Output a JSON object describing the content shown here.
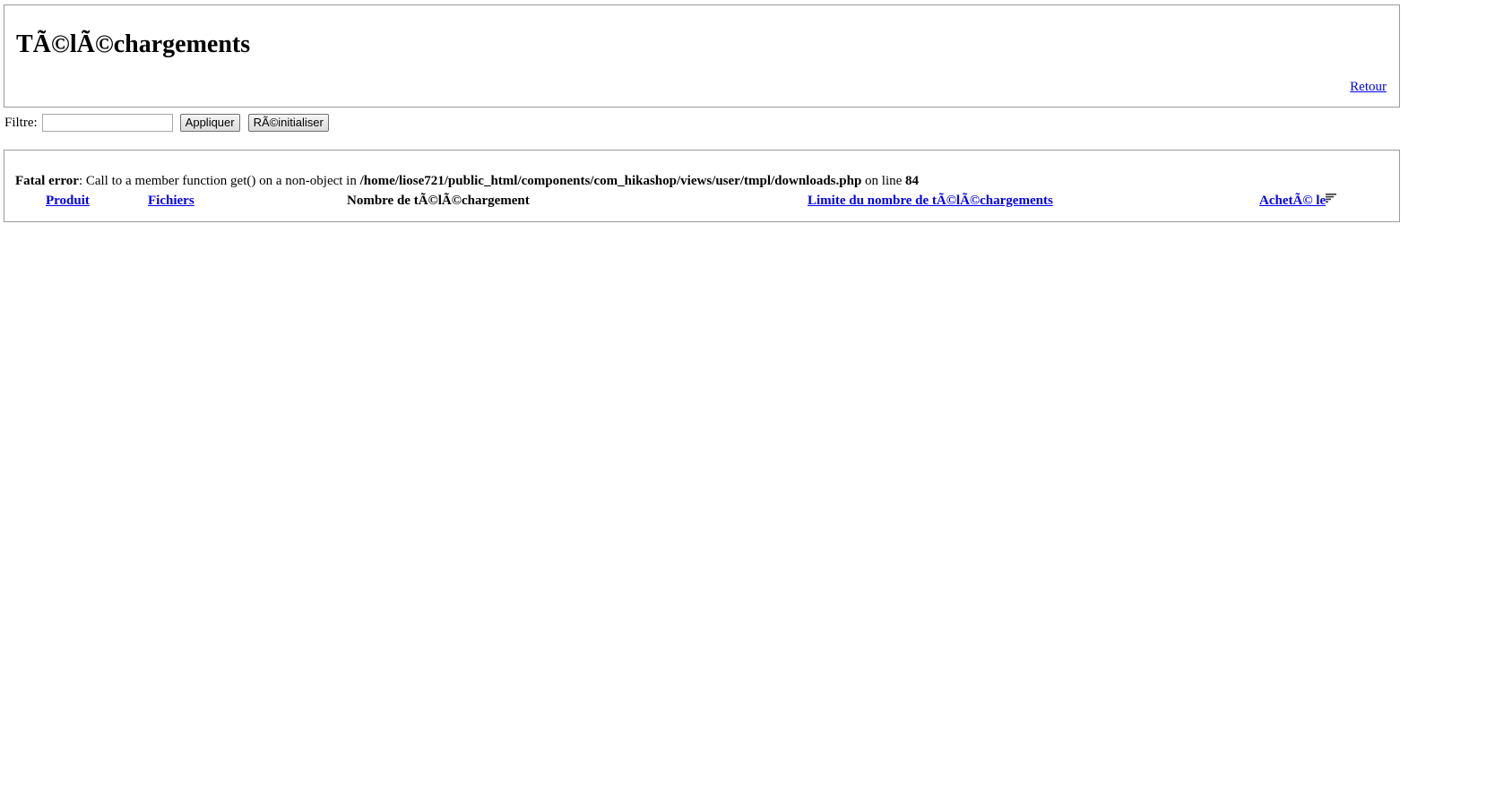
{
  "header": {
    "title": "TÃ©lÃ©chargements",
    "back_label": "Retour"
  },
  "filter": {
    "label": "Filtre:",
    "input_value": "",
    "apply_label": "Appliquer",
    "reset_label": "RÃ©initialiser"
  },
  "error": {
    "prefix": "Fatal error",
    "message": ": Call to a member function get() on a non-object in ",
    "path": "/home/liose721/public_html/components/com_hikashop/views/user/tmpl/downloads.php",
    "line_text": " on line ",
    "line_number": "84"
  },
  "table": {
    "columns": {
      "product": "Produit",
      "files": "Fichiers",
      "download_count": "Nombre de tÃ©lÃ©chargement",
      "download_limit": "Limite du nombre de tÃ©lÃ©chargements",
      "purchased_on": "AchetÃ© le"
    },
    "sort_icon": "sort-descending-icon"
  },
  "colors": {
    "link": "#0000ee",
    "border": "#9a9a9a"
  }
}
